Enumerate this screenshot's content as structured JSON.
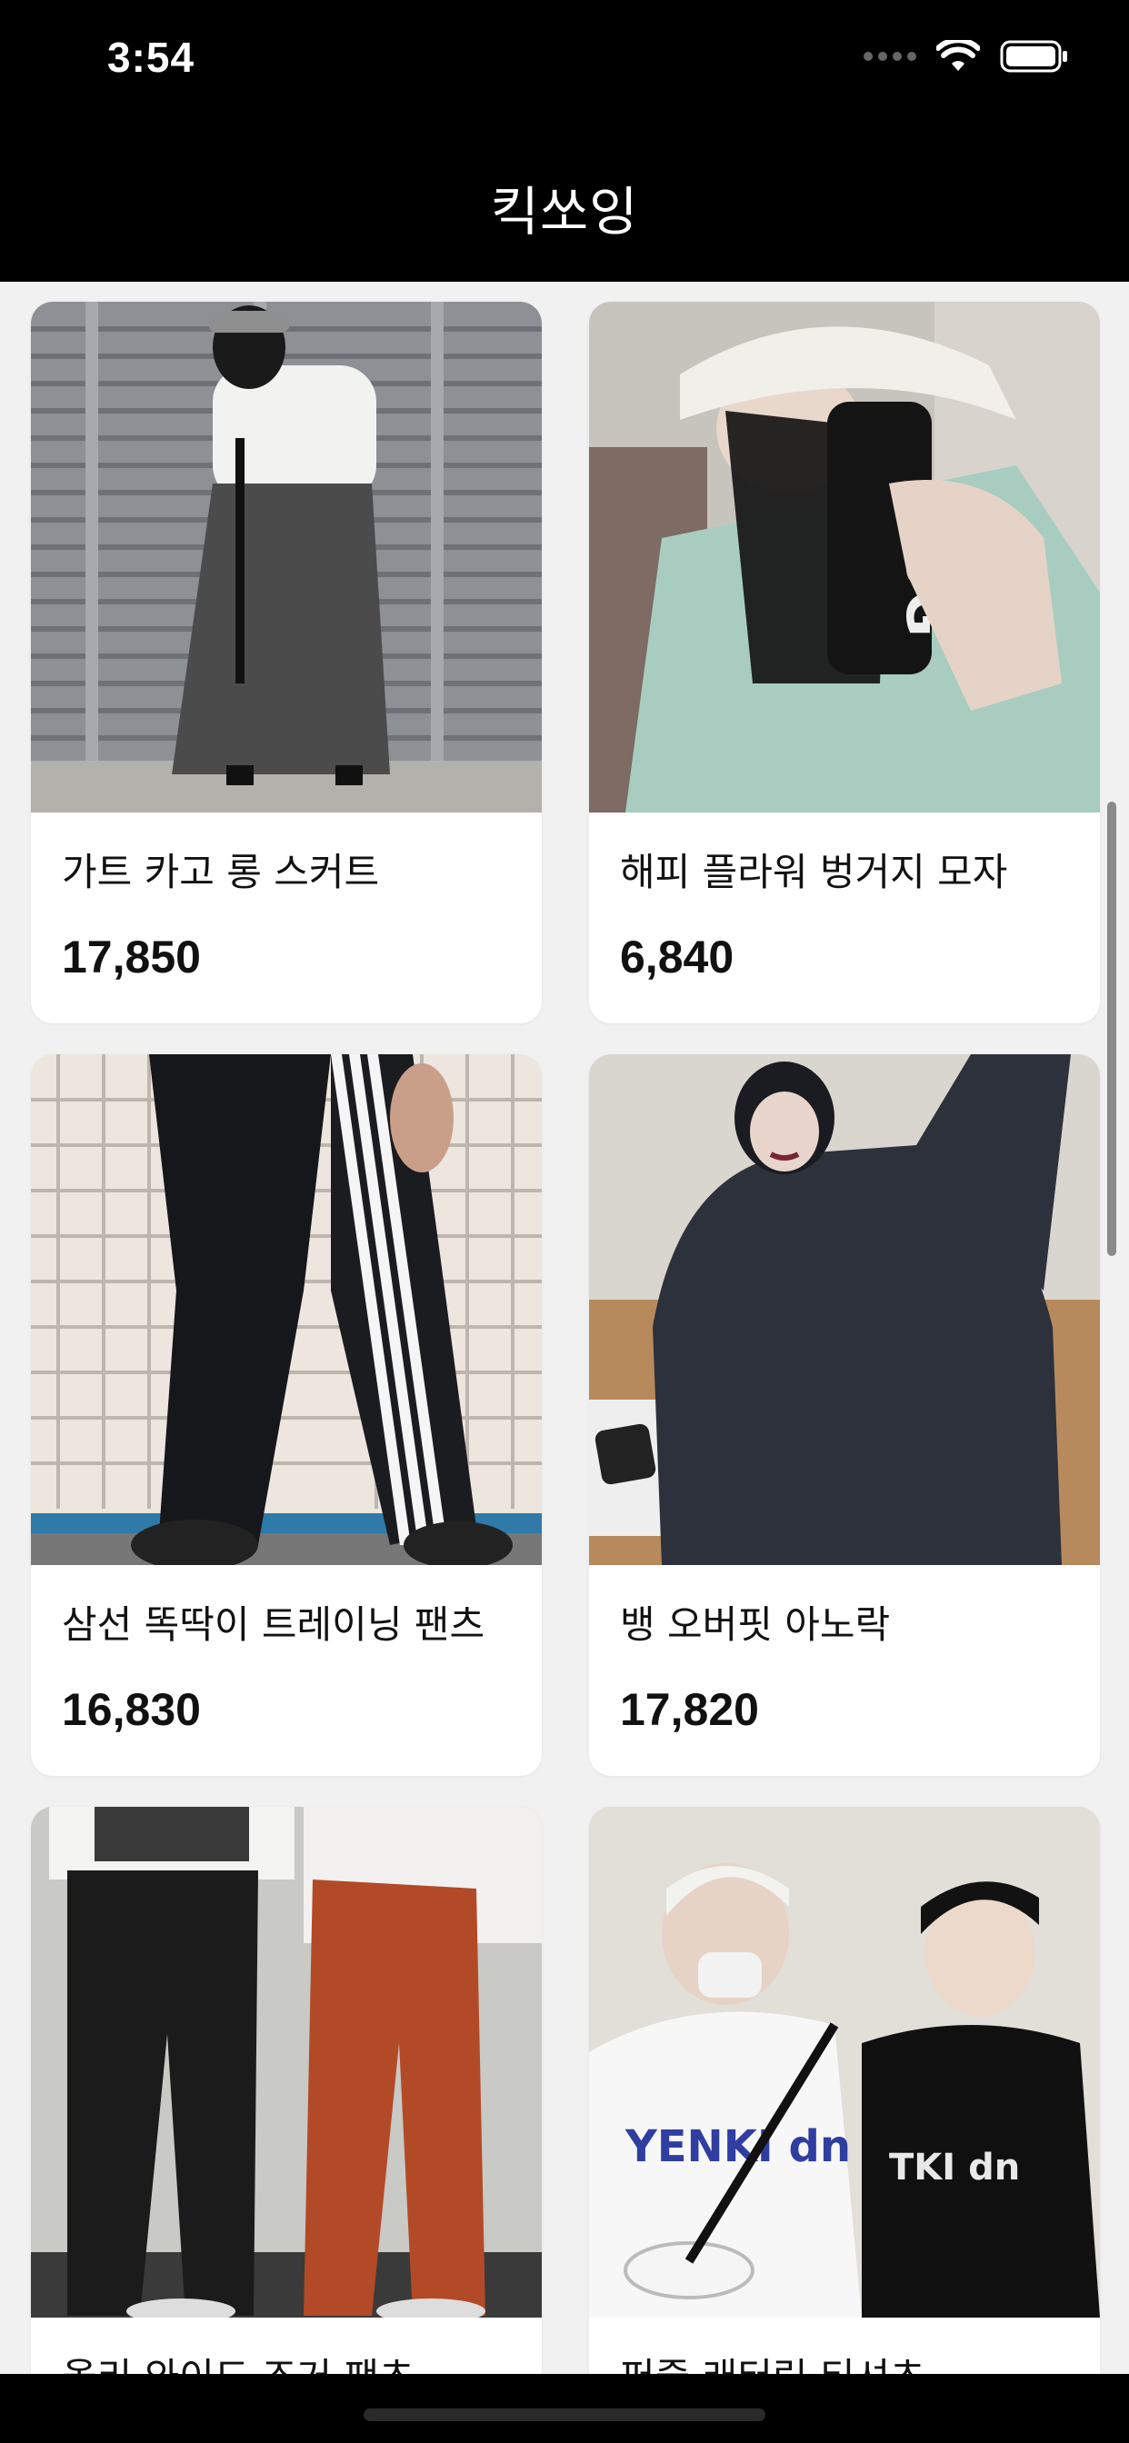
{
  "status_bar": {
    "time": "3:54"
  },
  "nav": {
    "title": "킥쏘잉"
  },
  "products": [
    {
      "name": "가트 카고 롱 스커트",
      "price": "17,850"
    },
    {
      "name": "해피 플라워 벙거지 모자",
      "price": "6,840"
    },
    {
      "name": "삼선 똑딱이 트레이닝 팬츠",
      "price": "16,830"
    },
    {
      "name": "뱅 오버핏 아노락",
      "price": "17,820"
    },
    {
      "name": "올리 와이드 조거 팬츠",
      "price": ""
    },
    {
      "name": "퍼즐 래터링 티셔츠",
      "price": ""
    }
  ],
  "icons": {
    "wifi": "wifi-icon",
    "battery": "battery-icon",
    "signal": "cellular-signal-icon"
  },
  "colors": {
    "bar_background": "#000000",
    "page_background": "#f1f1f1",
    "card_background": "#ffffff"
  }
}
